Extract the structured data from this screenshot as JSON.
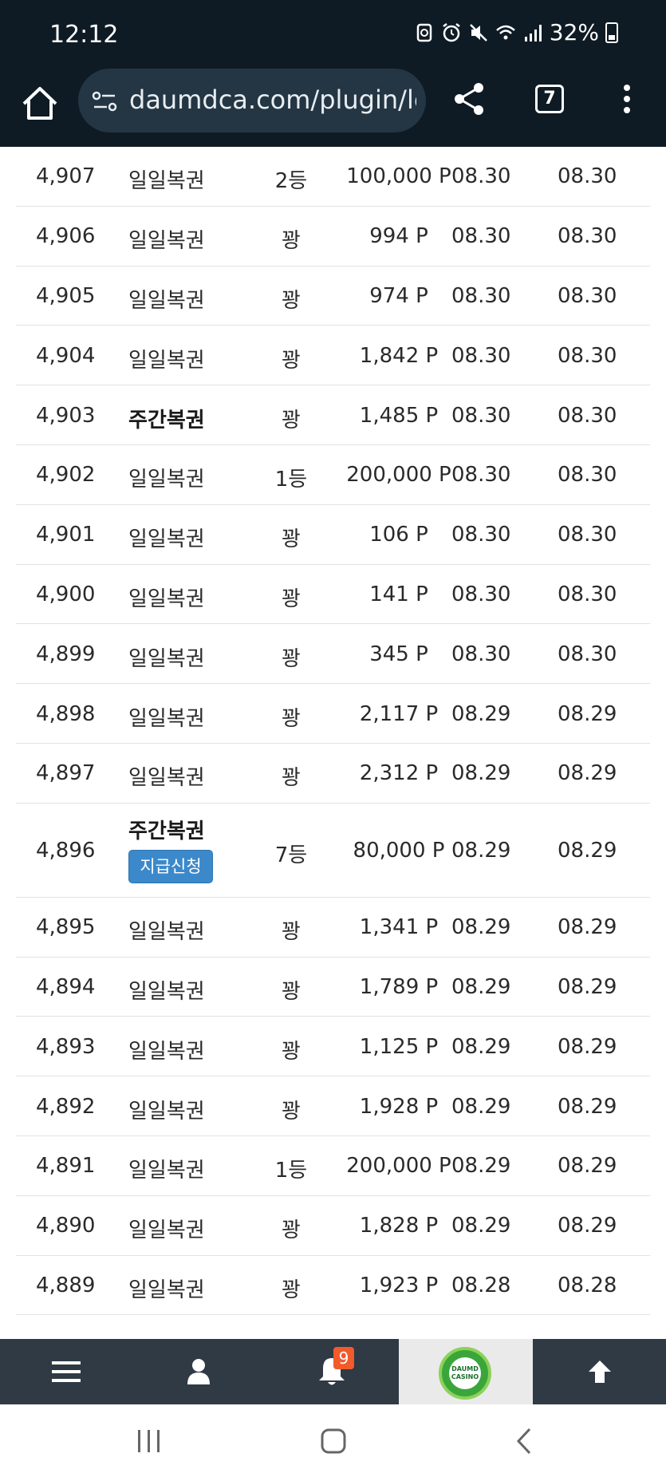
{
  "status_bar": {
    "time": "12:12",
    "battery": "32%"
  },
  "browser": {
    "url": "daumdca.com/plugin/lc",
    "tab_count": "7"
  },
  "rows": [
    {
      "num": "4,907",
      "type": "일일복권",
      "rank": "2등",
      "amount": "100,000 P",
      "date1": "08.30",
      "date2": "08.30",
      "bold": false
    },
    {
      "num": "4,906",
      "type": "일일복권",
      "rank": "꽝",
      "amount": "994 P",
      "date1": "08.30",
      "date2": "08.30",
      "bold": false
    },
    {
      "num": "4,905",
      "type": "일일복권",
      "rank": "꽝",
      "amount": "974 P",
      "date1": "08.30",
      "date2": "08.30",
      "bold": false
    },
    {
      "num": "4,904",
      "type": "일일복권",
      "rank": "꽝",
      "amount": "1,842 P",
      "date1": "08.30",
      "date2": "08.30",
      "bold": false
    },
    {
      "num": "4,903",
      "type": "주간복권",
      "rank": "꽝",
      "amount": "1,485 P",
      "date1": "08.30",
      "date2": "08.30",
      "bold": true
    },
    {
      "num": "4,902",
      "type": "일일복권",
      "rank": "1등",
      "amount": "200,000 P",
      "date1": "08.30",
      "date2": "08.30",
      "bold": false
    },
    {
      "num": "4,901",
      "type": "일일복권",
      "rank": "꽝",
      "amount": "106 P",
      "date1": "08.30",
      "date2": "08.30",
      "bold": false
    },
    {
      "num": "4,900",
      "type": "일일복권",
      "rank": "꽝",
      "amount": "141 P",
      "date1": "08.30",
      "date2": "08.30",
      "bold": false
    },
    {
      "num": "4,899",
      "type": "일일복권",
      "rank": "꽝",
      "amount": "345 P",
      "date1": "08.30",
      "date2": "08.30",
      "bold": false
    },
    {
      "num": "4,898",
      "type": "일일복권",
      "rank": "꽝",
      "amount": "2,117 P",
      "date1": "08.29",
      "date2": "08.29",
      "bold": false
    },
    {
      "num": "4,897",
      "type": "일일복권",
      "rank": "꽝",
      "amount": "2,312 P",
      "date1": "08.29",
      "date2": "08.29",
      "bold": false
    },
    {
      "num": "4,896",
      "type": "주간복권",
      "rank": "7등",
      "amount": "80,000 P",
      "date1": "08.29",
      "date2": "08.29",
      "bold": true,
      "claim": "지급신청"
    },
    {
      "num": "4,895",
      "type": "일일복권",
      "rank": "꽝",
      "amount": "1,341 P",
      "date1": "08.29",
      "date2": "08.29",
      "bold": false
    },
    {
      "num": "4,894",
      "type": "일일복권",
      "rank": "꽝",
      "amount": "1,789 P",
      "date1": "08.29",
      "date2": "08.29",
      "bold": false
    },
    {
      "num": "4,893",
      "type": "일일복권",
      "rank": "꽝",
      "amount": "1,125 P",
      "date1": "08.29",
      "date2": "08.29",
      "bold": false
    },
    {
      "num": "4,892",
      "type": "일일복권",
      "rank": "꽝",
      "amount": "1,928 P",
      "date1": "08.29",
      "date2": "08.29",
      "bold": false
    },
    {
      "num": "4,891",
      "type": "일일복권",
      "rank": "1등",
      "amount": "200,000 P",
      "date1": "08.29",
      "date2": "08.29",
      "bold": false
    },
    {
      "num": "4,890",
      "type": "일일복권",
      "rank": "꽝",
      "amount": "1,828 P",
      "date1": "08.29",
      "date2": "08.29",
      "bold": false
    },
    {
      "num": "4,889",
      "type": "일일복권",
      "rank": "꽝",
      "amount": "1,923 P",
      "date1": "08.28",
      "date2": "08.28",
      "bold": false
    }
  ],
  "bottom_nav": {
    "notification_count": "9",
    "logo_text": "DAUMD CASINO",
    "items": [
      "menu-icon",
      "user-icon",
      "bell-icon",
      "daumd-casino-logo",
      "arrow-up-icon"
    ]
  },
  "colors": {
    "status_bg": "#0f1b24",
    "url_bg": "#243644",
    "nav_bg": "#2f3a44",
    "claim_button": "#3b89cb",
    "badge": "#f15a2b"
  }
}
